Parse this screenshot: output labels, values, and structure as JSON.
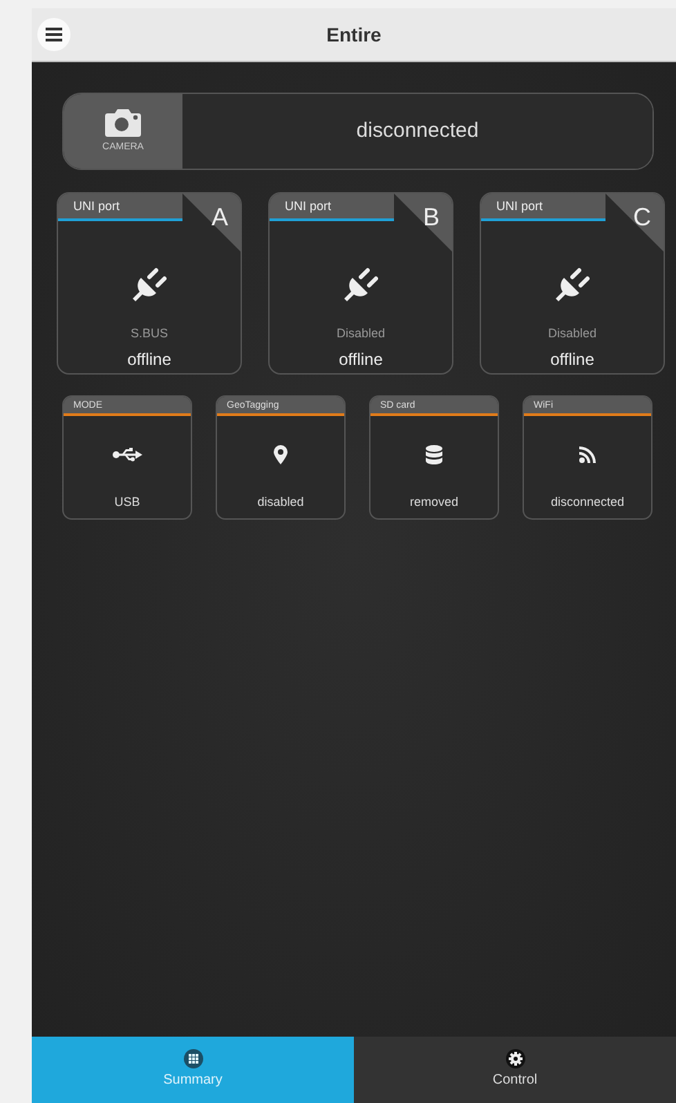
{
  "header": {
    "title": "Entire"
  },
  "camera": {
    "label": "CAMERA",
    "status": "disconnected"
  },
  "ports": [
    {
      "title": "UNI port",
      "letter": "A",
      "protocol": "S.BUS",
      "status": "offline"
    },
    {
      "title": "UNI port",
      "letter": "B",
      "protocol": "Disabled",
      "status": "offline"
    },
    {
      "title": "UNI port",
      "letter": "C",
      "protocol": "Disabled",
      "status": "offline"
    }
  ],
  "tiles": [
    {
      "title": "MODE",
      "value": "USB"
    },
    {
      "title": "GeoTagging",
      "value": "disabled"
    },
    {
      "title": "SD card",
      "value": "removed"
    },
    {
      "title": "WiFi",
      "value": "disconnected"
    }
  ],
  "tabs": [
    {
      "label": "Summary",
      "selected": true
    },
    {
      "label": "Control",
      "selected": false
    }
  ]
}
